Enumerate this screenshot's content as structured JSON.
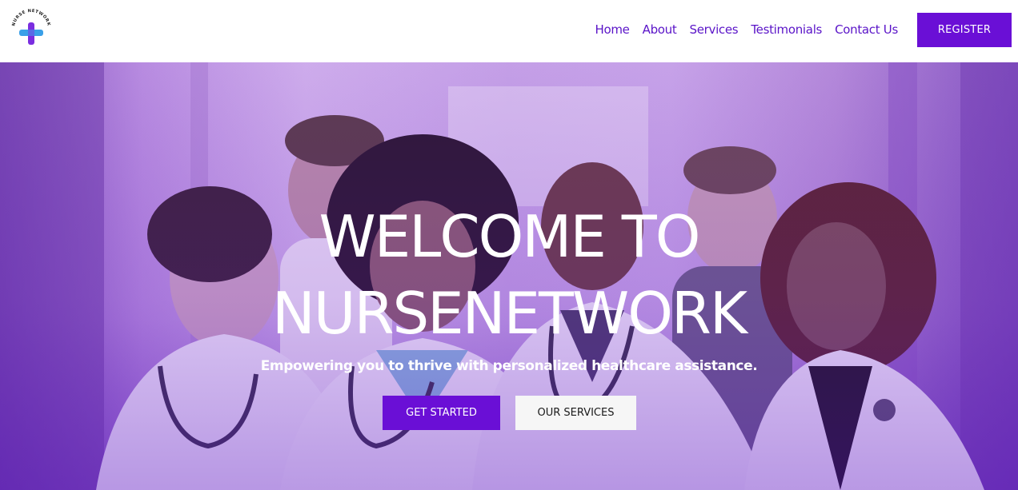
{
  "header": {
    "logo_text": "NURSE NETWORK",
    "nav": [
      {
        "label": "Home"
      },
      {
        "label": "About"
      },
      {
        "label": "Services"
      },
      {
        "label": "Testimonials"
      },
      {
        "label": "Contact Us"
      }
    ],
    "register_label": "REGISTER"
  },
  "hero": {
    "title_line1": "WELCOME TO",
    "title_line2": "NURSENETWORK",
    "subtitle": "Empowering you to thrive with personalized healthcare assistance.",
    "get_started_label": "GET STARTED",
    "our_services_label": "OUR SERVICES",
    "background_image": "team-of-smiling-healthcare-workers-photo"
  },
  "colors": {
    "accent": "#6a0fd6",
    "nav_text": "#5a14c8",
    "logo_blue": "#3aa0e8",
    "logo_purple": "#7a2ee0"
  }
}
